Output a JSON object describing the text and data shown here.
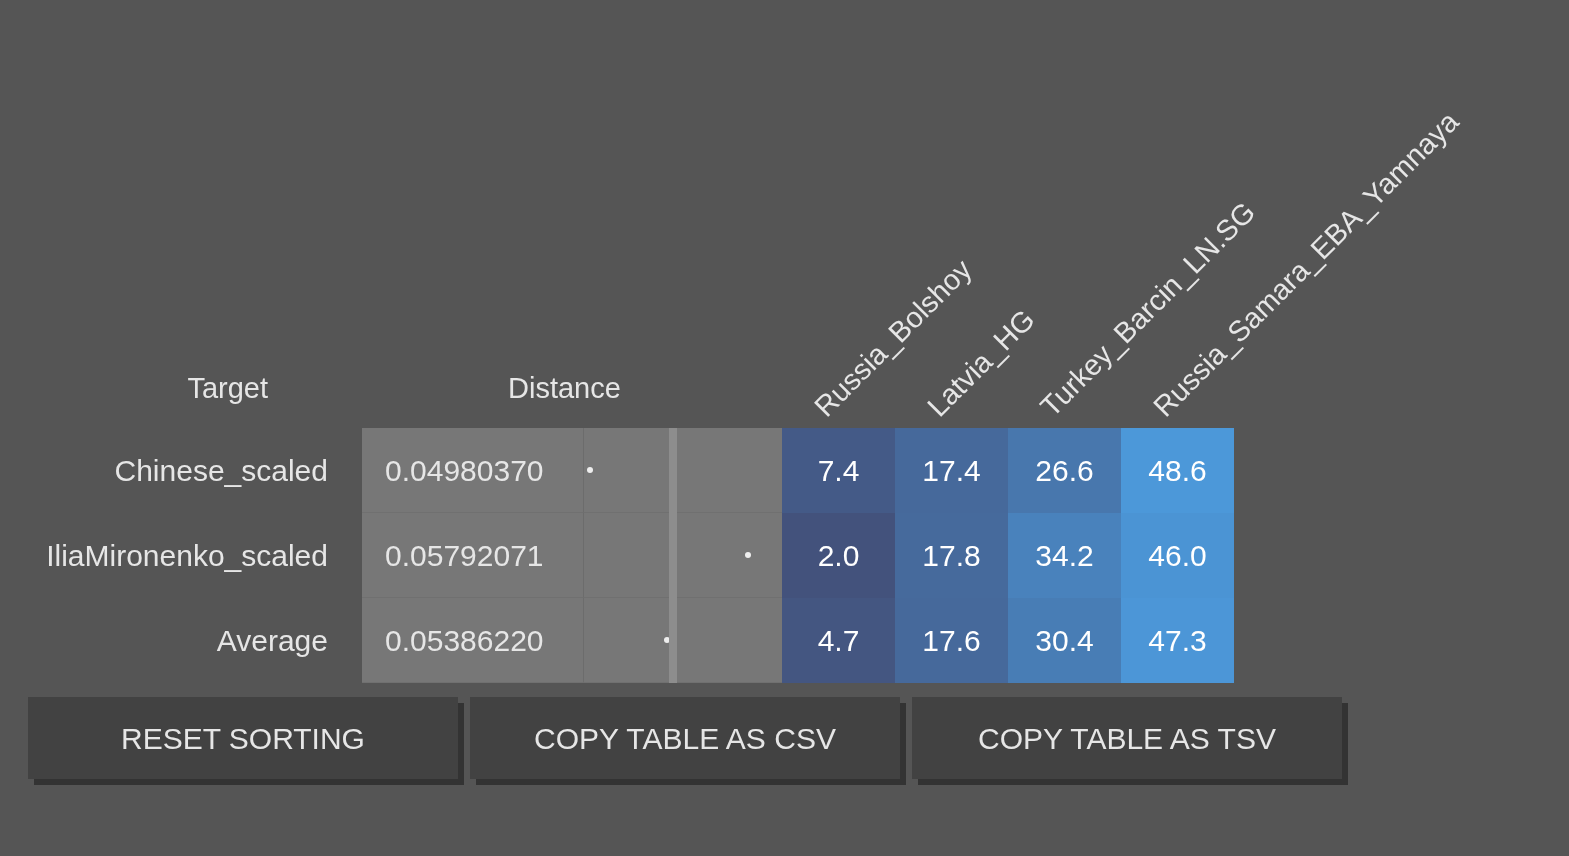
{
  "columns": {
    "target": "Target",
    "distance": "Distance",
    "populations": [
      "Russia_Bolshoy",
      "Latvia_HG",
      "Turkey_Barcin_LN.SG",
      "Russia_Samara_EBA_Yamnaya"
    ]
  },
  "rows": [
    {
      "kind": "sample",
      "target": "Chinese_scaled",
      "distance": "0.04980370",
      "level": 0.03,
      "values": [
        "7.4",
        "17.4",
        "26.6",
        "48.6"
      ]
    },
    {
      "kind": "sample",
      "target": "IliaMironenko_scaled",
      "distance": "0.05792071",
      "level": 0.83,
      "values": [
        "2.0",
        "17.8",
        "34.2",
        "46.0"
      ]
    },
    {
      "kind": "average",
      "target": "Average",
      "distance": "0.05386220",
      "level": 0.42,
      "values": [
        "4.7",
        "17.6",
        "30.4",
        "47.3"
      ]
    }
  ],
  "buttons": [
    "RESET SORTING",
    "COPY TABLE AS CSV",
    "COPY TABLE AS TSV"
  ]
}
